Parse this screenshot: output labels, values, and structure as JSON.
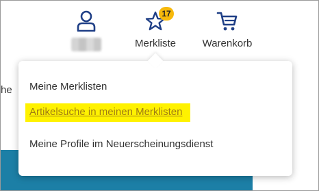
{
  "header": {
    "account": {
      "icon": "user-icon"
    },
    "merkliste": {
      "icon": "star-icon",
      "label": "Merkliste",
      "badge": "17"
    },
    "warenkorb": {
      "icon": "shopping-cart-icon",
      "label": "Warenkorb"
    }
  },
  "left_fragment": "he",
  "dropdown": {
    "items": [
      {
        "label": "Meine Merklisten"
      },
      {
        "label": "Artikelsuche in meinen Merklisten"
      },
      {
        "label": "Meine Profile im Neuerscheinungsdienst"
      }
    ]
  },
  "colors": {
    "icon": "#1f3f86",
    "badge": "#f7b90b",
    "highlight": "#fff200",
    "link": "#a07c14",
    "teal": "#1c7fa6"
  }
}
